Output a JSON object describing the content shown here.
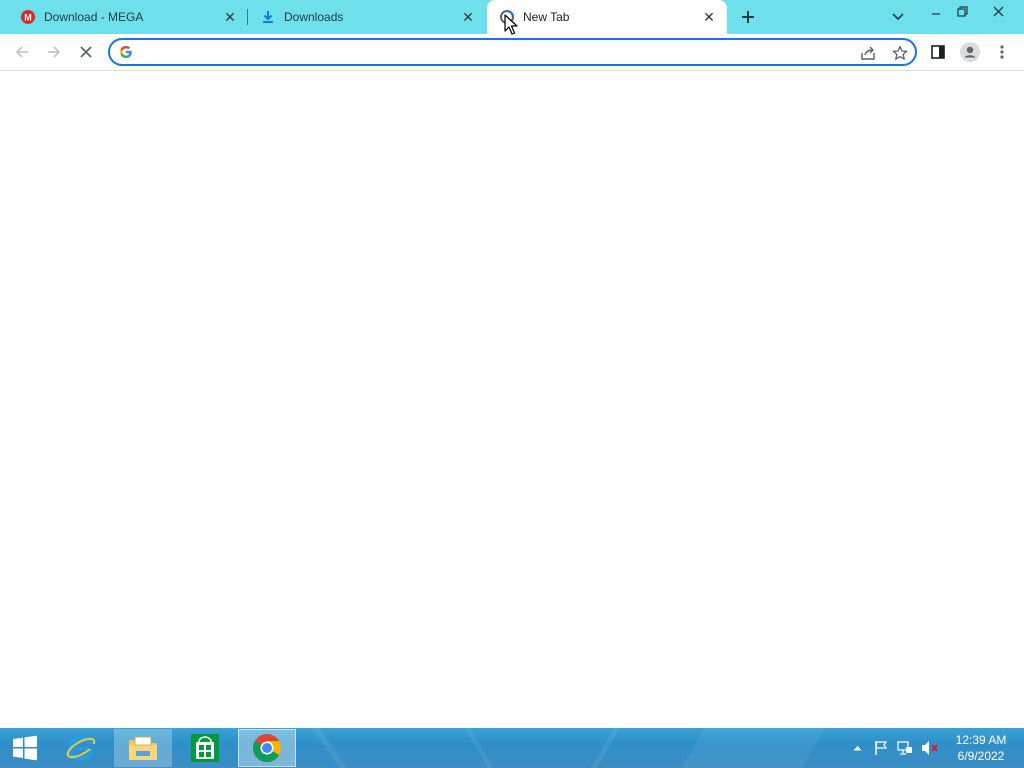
{
  "tabs": [
    {
      "title": "Download - MEGA",
      "favicon": "mega-icon",
      "active": false
    },
    {
      "title": "Downloads",
      "favicon": "download-icon",
      "active": false
    },
    {
      "title": "New Tab",
      "favicon": "loading-icon",
      "active": true
    }
  ],
  "toolbar": {
    "omnibox_value": "",
    "omnibox_placeholder": ""
  },
  "taskbar": {
    "apps": [
      {
        "name": "Internet Explorer",
        "icon": "ie-icon"
      },
      {
        "name": "File Explorer",
        "icon": "folder-icon"
      },
      {
        "name": "Store",
        "icon": "store-icon"
      },
      {
        "name": "Google Chrome",
        "icon": "chrome-icon",
        "active": true
      }
    ],
    "clock": {
      "time": "12:39 AM",
      "date": "6/9/2022"
    }
  },
  "colors": {
    "tabstrip": "#6de0ec",
    "accent": "#1a73e8",
    "mega_red": "#d9272e",
    "taskbar": "#2f8fc8"
  }
}
